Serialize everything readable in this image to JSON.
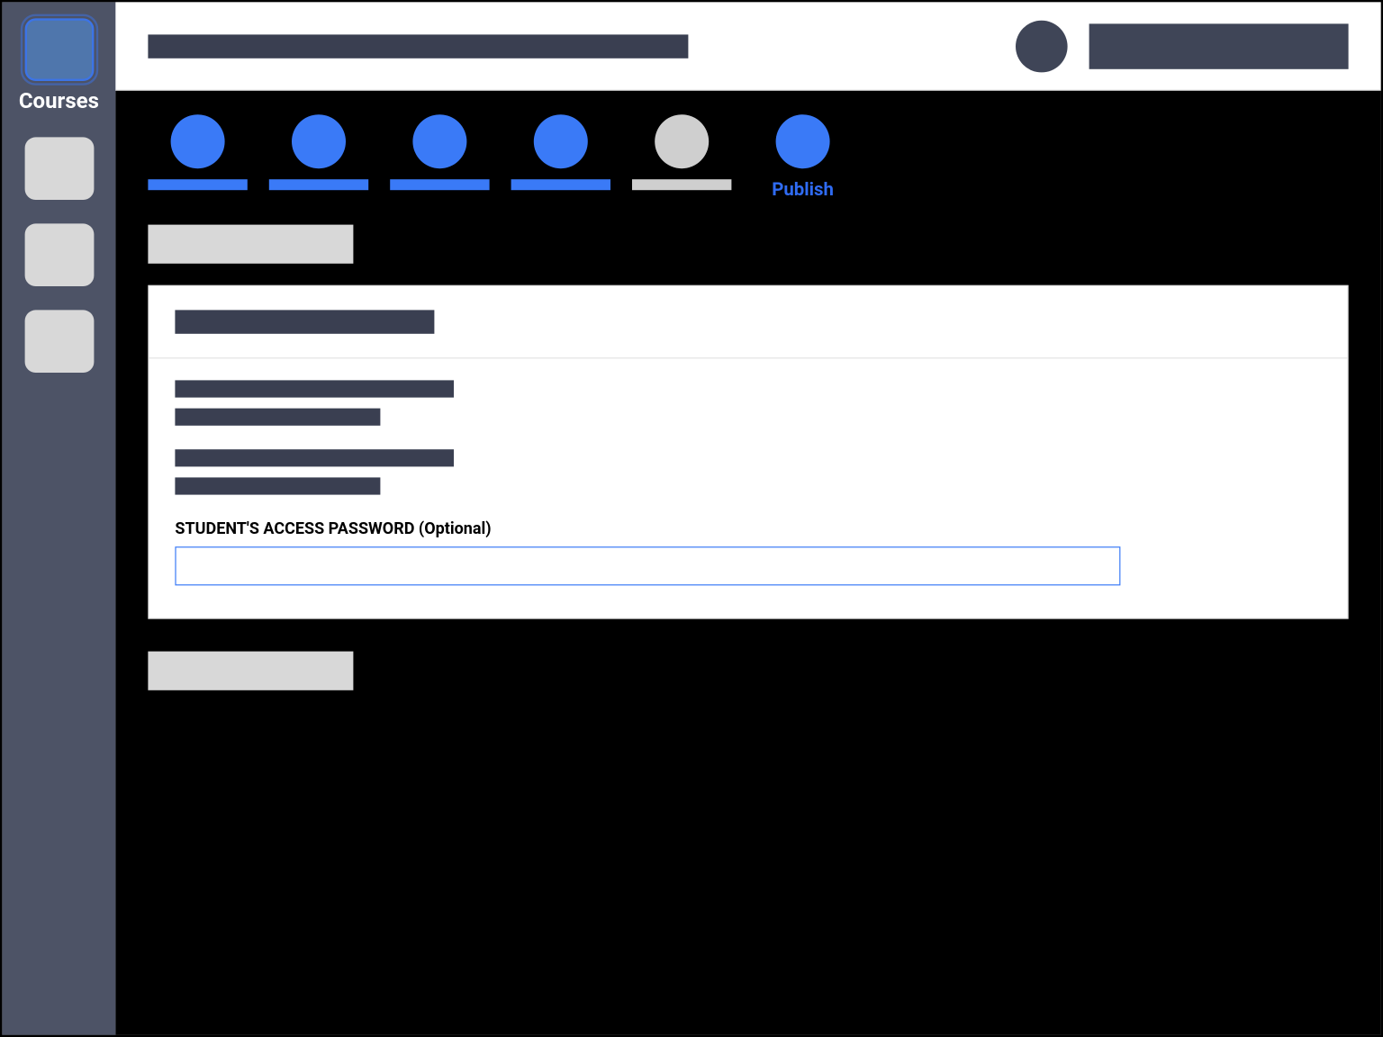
{
  "sidebar": {
    "items": [
      {
        "label": "Courses",
        "active": true
      },
      {
        "label": "",
        "active": false
      },
      {
        "label": "",
        "active": false
      },
      {
        "label": "",
        "active": false
      }
    ]
  },
  "topbar": {
    "title_placeholder": "",
    "user_placeholder": ""
  },
  "stepper": {
    "steps": [
      {
        "label": "",
        "state": "done"
      },
      {
        "label": "",
        "state": "done"
      },
      {
        "label": "",
        "state": "done"
      },
      {
        "label": "",
        "state": "done"
      },
      {
        "label": "",
        "state": "current"
      },
      {
        "label": "Publish",
        "state": "next"
      }
    ]
  },
  "section": {
    "title_placeholder": ""
  },
  "panel": {
    "heading_placeholder": "",
    "block1_line1": "",
    "block1_line2": "",
    "block2_line1": "",
    "block2_line2": "",
    "password_field_label": "STUDENT'S ACCESS PASSWORD (Optional)",
    "password_value": ""
  },
  "bottom_button_label": "",
  "colors": {
    "sidebar_bg": "#4d5366",
    "accent": "#3a7af7",
    "dark_bar": "#3a3f51",
    "placeholder_gray": "#d8d8d8"
  }
}
